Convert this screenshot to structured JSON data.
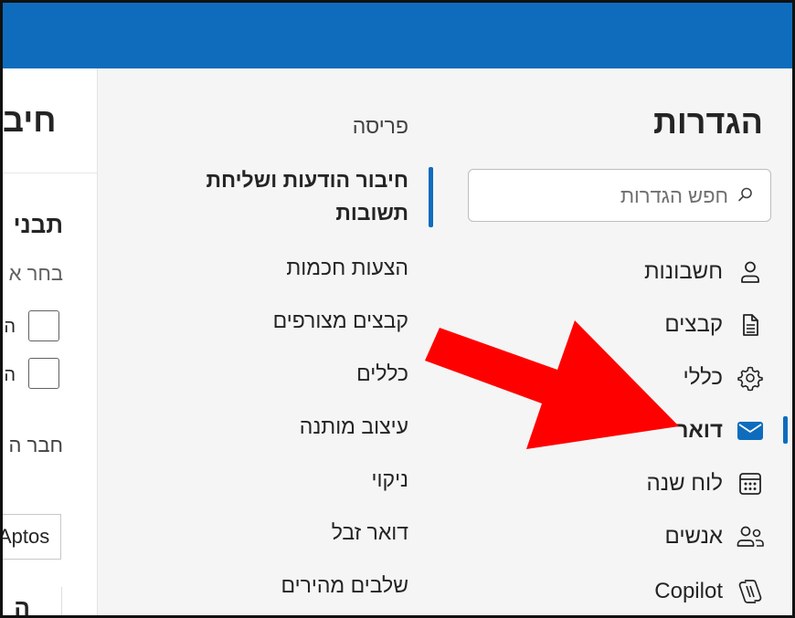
{
  "settings_nav": {
    "title": "הגדרות",
    "search": {
      "placeholder": "חפש הגדרות"
    },
    "items": [
      {
        "label": "חשבונות",
        "icon": "person-icon"
      },
      {
        "label": "קבצים",
        "icon": "document-icon"
      },
      {
        "label": "כללי",
        "icon": "gear-icon"
      },
      {
        "label": "דואר",
        "icon": "mail-icon",
        "active": true
      },
      {
        "label": "לוח שנה",
        "icon": "calendar-icon"
      },
      {
        "label": "אנשים",
        "icon": "people-icon"
      },
      {
        "label": "Copilot",
        "icon": "copilot-icon"
      }
    ]
  },
  "mail_subnav": {
    "items": [
      {
        "label": "פריסה"
      },
      {
        "label": "חיבור הודעות ושליחת תשובות",
        "active": true
      },
      {
        "label": "הצעות חכמות"
      },
      {
        "label": "קבצים מצורפים"
      },
      {
        "label": "כללים"
      },
      {
        "label": "עיצוב מותנה"
      },
      {
        "label": "ניקוי"
      },
      {
        "label": "דואר זבל"
      },
      {
        "label": "שלבים מהירים"
      }
    ]
  },
  "content": {
    "title_fragment": "חיב",
    "section_fragment": "תבני",
    "subtitle_fragment": "בחר א",
    "checkbox_label_1": "ה",
    "checkbox_label_2": "ה",
    "text_fragment": "חבר ה",
    "font_value": "Aptos",
    "heading_fragment": "ה"
  },
  "annotation": {
    "color": "#ff0000"
  },
  "colors": {
    "accent": "#0f6cbd",
    "header": "#0f6cbd"
  }
}
